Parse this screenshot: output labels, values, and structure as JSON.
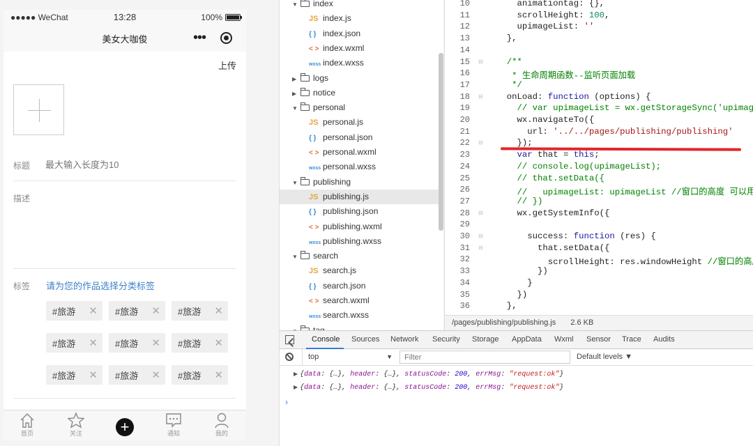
{
  "simulator": {
    "status": {
      "carrier": "●●●●● WeChat",
      "time": "13:28",
      "battery": "100%"
    },
    "nav_title": "美女大咖俊",
    "upload_label": "上传",
    "title_label": "标题",
    "title_placeholder": "最大输入长度为10",
    "desc_label": "描述",
    "tag_label": "标签",
    "tag_prompt": "请为您的作品选择分类标签",
    "tags": [
      "#旅游",
      "#旅游",
      "#旅游",
      "#旅游",
      "#旅游",
      "#旅游",
      "#旅游",
      "#旅游",
      "#旅游"
    ],
    "tag_remove_glyph": "✕",
    "tabbar": [
      {
        "label": "首页",
        "icon": "home-icon"
      },
      {
        "label": "关注",
        "icon": "star-icon"
      },
      {
        "label": "",
        "icon": "plus-icon"
      },
      {
        "label": "通知",
        "icon": "message-icon"
      },
      {
        "label": "我的",
        "icon": "user-icon"
      }
    ]
  },
  "file_tree": [
    {
      "type": "folder",
      "name": "index",
      "open": true
    },
    {
      "type": "js",
      "name": "index.js"
    },
    {
      "type": "json",
      "name": "index.json"
    },
    {
      "type": "wxml",
      "name": "index.wxml"
    },
    {
      "type": "wxss",
      "name": "index.wxss"
    },
    {
      "type": "folder",
      "name": "logs",
      "open": false
    },
    {
      "type": "folder",
      "name": "notice",
      "open": false
    },
    {
      "type": "folder",
      "name": "personal",
      "open": true
    },
    {
      "type": "js",
      "name": "personal.js"
    },
    {
      "type": "json",
      "name": "personal.json"
    },
    {
      "type": "wxml",
      "name": "personal.wxml"
    },
    {
      "type": "wxss",
      "name": "personal.wxss"
    },
    {
      "type": "folder",
      "name": "publishing",
      "open": true
    },
    {
      "type": "js",
      "name": "publishing.js",
      "selected": true
    },
    {
      "type": "json",
      "name": "publishing.json"
    },
    {
      "type": "wxml",
      "name": "publishing.wxml"
    },
    {
      "type": "wxss",
      "name": "publishing.wxss"
    },
    {
      "type": "folder",
      "name": "search",
      "open": true
    },
    {
      "type": "js",
      "name": "search.js"
    },
    {
      "type": "json",
      "name": "search.json"
    },
    {
      "type": "wxml",
      "name": "search.wxml"
    },
    {
      "type": "wxss",
      "name": "search.wxss"
    },
    {
      "type": "folder",
      "name": "tag",
      "open": true
    }
  ],
  "file_icon_glyphs": {
    "js": "JS",
    "json": "{ }",
    "wxml": "< >",
    "wxss": "wxss"
  },
  "editor": {
    "lines": [
      {
        "n": "10",
        "html": "    animationtag: {},"
      },
      {
        "n": "11",
        "html": "    scrollHeight: <span class=\"n\">100</span>,"
      },
      {
        "n": "12",
        "html": "    upimageList: <span class=\"s\">''</span>"
      },
      {
        "n": "13",
        "html": "  },"
      },
      {
        "n": "14",
        "html": ""
      },
      {
        "n": "15",
        "html": "  <span class=\"c\">/**</span>"
      },
      {
        "n": "16",
        "html": "  <span class=\"c\"> * 生命周期函数--监听页面加载</span>"
      },
      {
        "n": "17",
        "html": "  <span class=\"c\"> */</span>"
      },
      {
        "n": "18",
        "html": "  onLoad: <span class=\"k\">function</span> (options) {"
      },
      {
        "n": "19",
        "html": "    <span class=\"c\">// var upimageList = wx.getStorageSync('upimageList')</span>"
      },
      {
        "n": "20",
        "html": "    wx.navigateTo({"
      },
      {
        "n": "21",
        "html": "      url: <span class=\"s\">'../../pages/publishing/publishing'</span>"
      },
      {
        "n": "22",
        "html": "    });"
      },
      {
        "n": "23",
        "html": "    <span class=\"k\">var</span> that = <span class=\"k\">this</span>;"
      },
      {
        "n": "24",
        "html": "    <span class=\"c\">// console.log(upimageList);</span>"
      },
      {
        "n": "25",
        "html": "    <span class=\"c\">// that.setData({</span>"
      },
      {
        "n": "26",
        "html": "    <span class=\"c\">//   upimageList: upimageList //窗口的高度 可以用在动画</span>"
      },
      {
        "n": "27",
        "html": "    <span class=\"c\">// })</span>"
      },
      {
        "n": "28",
        "html": "    wx.getSystemInfo({"
      },
      {
        "n": "29",
        "html": ""
      },
      {
        "n": "30",
        "html": "      success: <span class=\"k\">function</span> (res) {"
      },
      {
        "n": "31",
        "html": "        that.setData({"
      },
      {
        "n": "32",
        "html": "          scrollHeight: res.windowHeight <span class=\"c\">//窗口的高度 可以</span>"
      },
      {
        "n": "33",
        "html": "        })"
      },
      {
        "n": "34",
        "html": "      }"
      },
      {
        "n": "35",
        "html": "    })"
      },
      {
        "n": "36",
        "html": "  },"
      }
    ],
    "fold_lines": [
      "15",
      "18",
      "22",
      "28",
      "30",
      "31"
    ],
    "fold_glyph": "⊟"
  },
  "editor_status": {
    "path": "/pages/publishing/publishing.js",
    "size": "2.6 KB"
  },
  "devtools": {
    "tabs": [
      "Console",
      "Sources",
      "Network",
      "Security",
      "Storage",
      "AppData",
      "Wxml",
      "Sensor",
      "Trace",
      "Audits"
    ],
    "active_tab": "Console",
    "context": "top",
    "context_arrow": "▼",
    "filter_placeholder": "Filter",
    "levels": "Default levels ▼",
    "logs": [
      "▶ {data: {…}, header: {…}, statusCode: 200, errMsg: \"request:ok\"}",
      "▶ {data: {…}, header: {…}, statusCode: 200, errMsg: \"request:ok\"}"
    ],
    "prompt": "›"
  },
  "colors": {
    "accent": "#3879d9",
    "annotation": "#e1262b",
    "tag_prompt": "#3d7fc9"
  }
}
